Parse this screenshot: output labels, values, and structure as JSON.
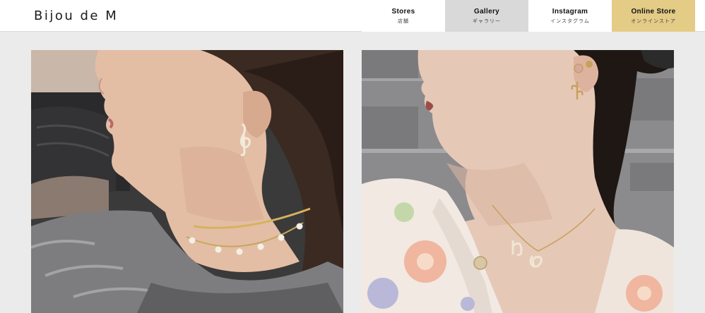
{
  "header": {
    "logo": "Bijou de M",
    "nav": [
      {
        "label": "Stores",
        "sublabel": "店舗"
      },
      {
        "label": "Gallery",
        "sublabel": "ギャラリー"
      },
      {
        "label": "Instagram",
        "sublabel": "インスタグラム"
      },
      {
        "label": "Online Store",
        "sublabel": "オンラインストア"
      }
    ]
  },
  "colors": {
    "page_background": "#ebebeb",
    "header_background": "#ffffff",
    "gallery_tab": "#d9d9d9",
    "online_store_tab": "#e4cb86"
  },
  "icons": [
    "treble-clef-earring",
    "rose-bee-earring",
    "initial-pendant-necklace"
  ]
}
